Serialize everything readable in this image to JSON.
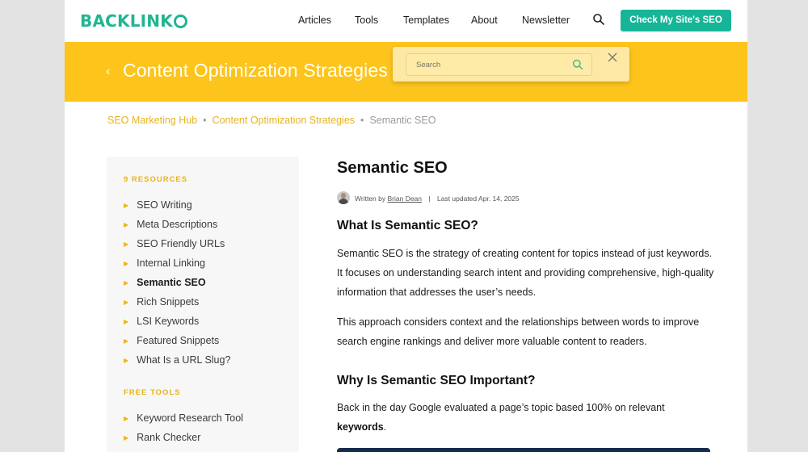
{
  "header": {
    "logo_text": "BACKLINK",
    "nav": [
      "Articles",
      "Tools",
      "Templates",
      "About",
      "Newsletter"
    ],
    "cta_label": "Check My Site's SEO",
    "brand_color": "#21b591"
  },
  "banner": {
    "back_icon": "chevron-left-icon",
    "title": "Content Optimization Strategies",
    "color": "#fdc41c"
  },
  "search": {
    "placeholder": "Search",
    "icon": "search-icon",
    "close_icon": "close-icon"
  },
  "breadcrumb": {
    "items": [
      "SEO Marketing Hub",
      "Content Optimization Strategies"
    ],
    "current": "Semantic SEO",
    "separator": "•"
  },
  "sidebar": {
    "resources_heading": "9 RESOURCES",
    "resources": [
      "SEO Writing",
      "Meta Descriptions",
      "SEO Friendly URLs",
      "Internal Linking",
      "Semantic SEO",
      "Rich Snippets",
      "LSI Keywords",
      "Featured Snippets",
      "What Is a URL Slug?"
    ],
    "active_resource": "Semantic SEO",
    "tools_heading": "FREE TOOLS",
    "tools": [
      "Keyword Research Tool",
      "Rank Checker"
    ]
  },
  "article": {
    "title": "Semantic SEO",
    "byline_prefix": "Written by",
    "author": "Brian Dean",
    "separator": "|",
    "updated": "Last updated Apr. 14, 2025",
    "h2_1": "What Is Semantic SEO?",
    "p1": "Semantic SEO is the strategy of creating content for topics instead of just keywords. It focuses on understanding search intent and providing comprehensive, high-quality information that addresses the user’s needs.",
    "p2": "This approach considers context and the relationships between words to improve search engine rankings and deliver more valuable content to readers.",
    "h2_2": "Why Is Semantic SEO Important?",
    "p3_text": "Back in the day Google evaluated a page’s topic based 100% on relevant",
    "p3_bold": "keywords",
    "p3_end": "."
  }
}
